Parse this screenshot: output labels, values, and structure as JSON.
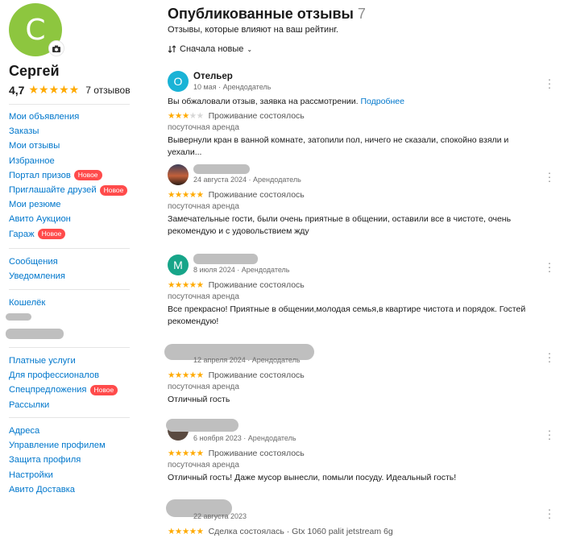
{
  "profile": {
    "avatar_letter": "С",
    "avatar_color": "#8dc63f",
    "name": "Сергей",
    "rating": "4,7",
    "stars": "★★★★★",
    "reviews_count": "7 отзывов"
  },
  "menu_groups": [
    {
      "items": [
        {
          "label": "Мои объявления"
        },
        {
          "label": "Заказы"
        },
        {
          "label": "Мои отзывы"
        },
        {
          "label": "Избранное"
        },
        {
          "label": "Портал призов",
          "badge": "Новое"
        },
        {
          "label": "Приглашайте друзей",
          "badge": "Новое"
        },
        {
          "label": "Мои резюме"
        },
        {
          "label": "Авито Аукцион"
        },
        {
          "label": "Гараж",
          "badge": "Новое"
        }
      ]
    },
    {
      "items": [
        {
          "label": "Сообщения"
        },
        {
          "label": "Уведомления"
        }
      ]
    },
    {
      "items": [
        {
          "label": "Кошелёк"
        }
      ]
    },
    {
      "items": [
        {
          "label": "Платные услуги"
        },
        {
          "label": "Для профессионалов"
        },
        {
          "label": "Спецпредложения",
          "badge": "Новое"
        },
        {
          "label": "Рассылки"
        }
      ]
    },
    {
      "items": [
        {
          "label": "Адреса"
        },
        {
          "label": "Управление профилем"
        },
        {
          "label": "Защита профиля"
        },
        {
          "label": "Настройки"
        },
        {
          "label": "Авито Доставка"
        }
      ]
    }
  ],
  "main": {
    "title": "Опубликованные отзывы",
    "count": "7",
    "subtitle": "Отзывы, которые влияют на ваш рейтинг.",
    "sort_label": "Сначала новые"
  },
  "reviews": [
    {
      "avatar_letter": "О",
      "avatar_color": "#1ab3d6",
      "name": "Отельер",
      "meta": "10 мая · Арендодатель",
      "notice": "Вы обжаловали отзыв, заявка на рассмотрении.",
      "notice_link": "Подробнее",
      "rating": 3,
      "status": "Проживание состоялось",
      "type": "посуточная аренда",
      "text": "Вывернули кран в ванной комнате, затопили пол, ничего не сказали, спокойно взяли и уехали..."
    },
    {
      "avatar_letter": "",
      "avatar_color": "#6b4a3a",
      "name": "",
      "meta": "24 августа 2024 · Арендодатель",
      "rating": 5,
      "status": "Проживание состоялось",
      "type": "посуточная аренда",
      "text": "Замечательные гости, были очень приятные в общении, оставили все в чистоте, очень рекомендую и с удовольствием жду"
    },
    {
      "avatar_letter": "М",
      "avatar_color": "#17a589",
      "name": "",
      "meta": "8 июля 2024 · Арендодатель",
      "rating": 5,
      "status": "Проживание состоялось",
      "type": "посуточная аренда",
      "text": "Все прекрасно! Приятные в общении,молодая семья,в квартире чистота и порядок. Гостей рекомендую!"
    },
    {
      "avatar_letter": "",
      "avatar_color": "#9a9a9a",
      "name": "",
      "meta": "12 апреля 2024 · Арендодатель",
      "rating": 5,
      "status": "Проживание состоялось",
      "type": "посуточная аренда",
      "text": "Отличный гость"
    },
    {
      "avatar_letter": "",
      "avatar_color": "#5a4a40",
      "name": "",
      "meta": "6 ноября 2023 · Арендодатель",
      "rating": 5,
      "status": "Проживание состоялось",
      "type": "посуточная аренда",
      "text": "Отличный гость! Даже мусор вынесли, помыли посуду. Идеальный гость!"
    },
    {
      "avatar_letter": "",
      "avatar_color": "#9a9a9a",
      "name": "",
      "meta": "22 августа 2023",
      "rating": 5,
      "status": "Сделка состоялась · Gtx 1060 palit jetstream 6g",
      "type": "",
      "text": ""
    }
  ],
  "colors": {
    "link": "#0077cc",
    "star": "#ffaa00",
    "badge": "#ff4b4b"
  }
}
